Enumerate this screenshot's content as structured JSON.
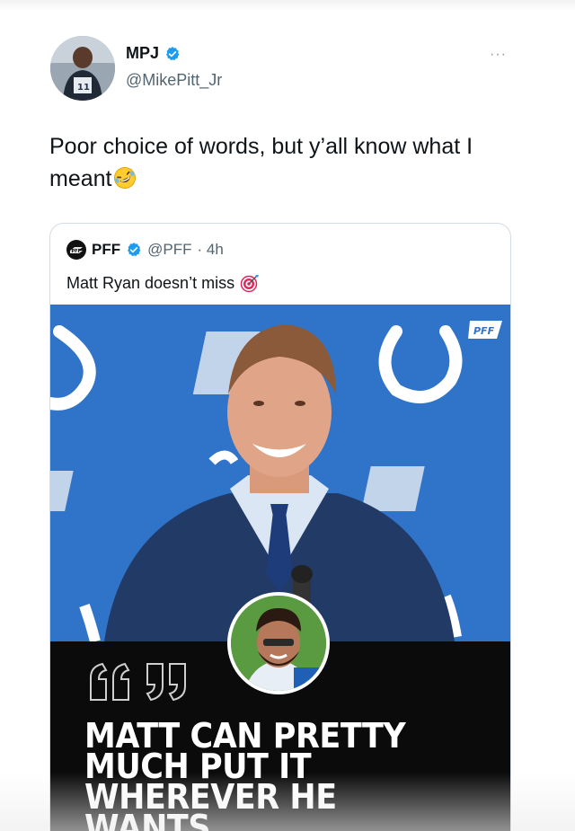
{
  "tweet": {
    "author_name": "MPJ",
    "author_handle": "@MikePitt_Jr",
    "more_label": "···",
    "text": "Poor choice of words, but y’all know what I meant"
  },
  "quoted": {
    "author_name": "PFF",
    "author_handle": "@PFF",
    "time": "· 4h",
    "text": "Matt Ryan doesn’t miss",
    "image": {
      "quote_glyph": "“”",
      "headline": "MATT CAN PRETTY MUCH PUT IT WHEREVER HE WANTS."
    }
  },
  "icons": {
    "verified": "verified-badge-icon",
    "emoji": "rolling-laughing-emoji-icon",
    "target": "bullseye-dart-icon",
    "pff": "pff-logo-icon"
  },
  "colors": {
    "verified_blue": "#1d9bf0",
    "photo_backdrop": "#2f74c8",
    "panel_black": "#0b0b0b"
  }
}
